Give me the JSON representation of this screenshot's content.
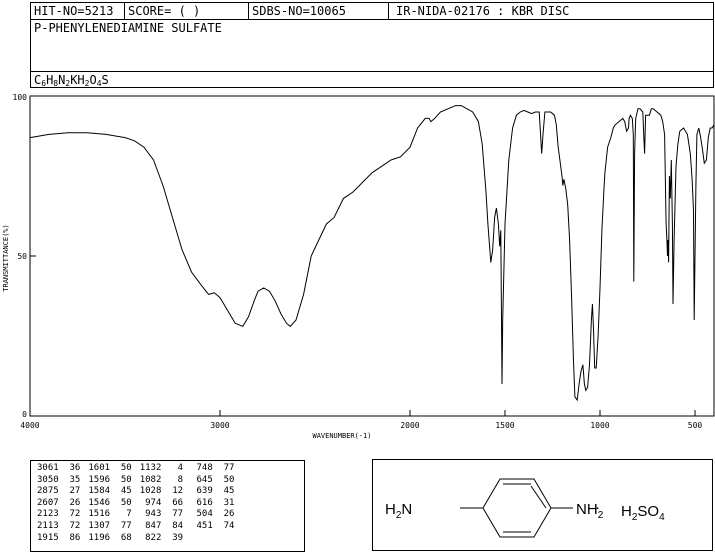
{
  "header": {
    "hit_no": "HIT-NO=5213",
    "score": "SCORE=  (   )",
    "sdbs_no": "SDBS-NO=10065",
    "ir_code": "IR-NIDA-02176 : KBR DISC",
    "compound_name": "P-PHENYLENEDIAMINE SULFATE",
    "formula": {
      "parts": [
        {
          "t": "C",
          "sub": "6"
        },
        {
          "t": "H",
          "sub": "8"
        },
        {
          "t": "N",
          "sub": "2"
        },
        {
          "t": "KH",
          "sub": "2"
        },
        {
          "t": "O",
          "sub": "4"
        },
        {
          "t": "S",
          "sub": ""
        }
      ]
    }
  },
  "chart_data": {
    "type": "line",
    "xlabel": "WAVENUMBER(-1)",
    "ylabel": "TRANSMITTANCE(%)",
    "xlim": [
      4000,
      400
    ],
    "ylim": [
      0,
      100
    ],
    "x_ticks": [
      4000,
      3000,
      2000,
      1500,
      1000,
      500
    ],
    "y_ticks": [
      0,
      50,
      100
    ],
    "grid": false,
    "series": [
      {
        "points": [
          [
            4000,
            87
          ],
          [
            3900,
            88
          ],
          [
            3800,
            88.5
          ],
          [
            3700,
            88.5
          ],
          [
            3600,
            88
          ],
          [
            3500,
            87
          ],
          [
            3450,
            86
          ],
          [
            3400,
            84
          ],
          [
            3350,
            80
          ],
          [
            3300,
            72
          ],
          [
            3250,
            62
          ],
          [
            3200,
            52
          ],
          [
            3150,
            45
          ],
          [
            3100,
            41
          ],
          [
            3060,
            38
          ],
          [
            3030,
            38.5
          ],
          [
            3000,
            37
          ],
          [
            2980,
            35
          ],
          [
            2950,
            32
          ],
          [
            2920,
            29
          ],
          [
            2880,
            28
          ],
          [
            2850,
            31
          ],
          [
            2820,
            36
          ],
          [
            2800,
            39
          ],
          [
            2770,
            40
          ],
          [
            2740,
            39
          ],
          [
            2710,
            36
          ],
          [
            2680,
            32
          ],
          [
            2650,
            29
          ],
          [
            2630,
            28
          ],
          [
            2600,
            30
          ],
          [
            2560,
            38
          ],
          [
            2520,
            50
          ],
          [
            2480,
            55
          ],
          [
            2440,
            60
          ],
          [
            2400,
            62
          ],
          [
            2350,
            68
          ],
          [
            2300,
            70
          ],
          [
            2250,
            73
          ],
          [
            2200,
            76
          ],
          [
            2150,
            78
          ],
          [
            2100,
            80
          ],
          [
            2050,
            81
          ],
          [
            2000,
            84
          ],
          [
            1960,
            90
          ],
          [
            1920,
            93
          ],
          [
            1900,
            93
          ],
          [
            1890,
            92
          ],
          [
            1870,
            93
          ],
          [
            1840,
            95
          ],
          [
            1800,
            96
          ],
          [
            1760,
            97
          ],
          [
            1730,
            97
          ],
          [
            1700,
            96
          ],
          [
            1670,
            95
          ],
          [
            1640,
            92
          ],
          [
            1620,
            85
          ],
          [
            1600,
            70
          ],
          [
            1590,
            60
          ],
          [
            1575,
            48
          ],
          [
            1565,
            52
          ],
          [
            1555,
            62
          ],
          [
            1545,
            65
          ],
          [
            1535,
            60
          ],
          [
            1528,
            53
          ],
          [
            1522,
            58
          ],
          [
            1516,
            10
          ],
          [
            1512,
            30
          ],
          [
            1500,
            60
          ],
          [
            1480,
            80
          ],
          [
            1460,
            90
          ],
          [
            1440,
            94
          ],
          [
            1420,
            95
          ],
          [
            1400,
            95.5
          ],
          [
            1380,
            95
          ],
          [
            1360,
            94.5
          ],
          [
            1340,
            95
          ],
          [
            1320,
            95
          ],
          [
            1307,
            82
          ],
          [
            1300,
            88
          ],
          [
            1290,
            95
          ],
          [
            1270,
            95
          ],
          [
            1260,
            95
          ],
          [
            1240,
            94
          ],
          [
            1230,
            91
          ],
          [
            1220,
            84
          ],
          [
            1200,
            75
          ],
          [
            1196,
            72
          ],
          [
            1190,
            74
          ],
          [
            1180,
            71
          ],
          [
            1170,
            66
          ],
          [
            1160,
            55
          ],
          [
            1150,
            38
          ],
          [
            1140,
            18
          ],
          [
            1132,
            6
          ],
          [
            1120,
            5
          ],
          [
            1110,
            10
          ],
          [
            1100,
            14
          ],
          [
            1090,
            16
          ],
          [
            1082,
            10
          ],
          [
            1075,
            8
          ],
          [
            1065,
            9
          ],
          [
            1055,
            16
          ],
          [
            1045,
            30
          ],
          [
            1040,
            35
          ],
          [
            1035,
            28
          ],
          [
            1028,
            15
          ],
          [
            1020,
            15
          ],
          [
            1010,
            25
          ],
          [
            1000,
            40
          ],
          [
            990,
            58
          ],
          [
            980,
            70
          ],
          [
            974,
            76
          ],
          [
            960,
            84
          ],
          [
            943,
            87
          ],
          [
            930,
            90
          ],
          [
            920,
            91
          ],
          [
            900,
            92
          ],
          [
            880,
            93
          ],
          [
            870,
            92
          ],
          [
            860,
            89
          ],
          [
            850,
            90
          ],
          [
            847,
            93
          ],
          [
            840,
            94
          ],
          [
            830,
            93
          ],
          [
            825,
            88
          ],
          [
            822,
            42
          ],
          [
            818,
            82
          ],
          [
            812,
            93
          ],
          [
            800,
            96
          ],
          [
            790,
            96
          ],
          [
            775,
            95
          ],
          [
            770,
            88
          ],
          [
            765,
            82
          ],
          [
            760,
            94
          ],
          [
            748,
            94
          ],
          [
            740,
            94
          ],
          [
            730,
            96
          ],
          [
            720,
            96
          ],
          [
            700,
            95
          ],
          [
            680,
            94
          ],
          [
            670,
            92
          ],
          [
            660,
            88
          ],
          [
            652,
            60
          ],
          [
            648,
            55
          ],
          [
            645,
            50
          ],
          [
            642,
            55
          ],
          [
            639,
            48
          ],
          [
            635,
            75
          ],
          [
            630,
            68
          ],
          [
            625,
            80
          ],
          [
            619,
            60
          ],
          [
            616,
            35
          ],
          [
            610,
            55
          ],
          [
            600,
            78
          ],
          [
            590,
            85
          ],
          [
            580,
            89
          ],
          [
            560,
            90
          ],
          [
            540,
            88
          ],
          [
            525,
            82
          ],
          [
            515,
            74
          ],
          [
            508,
            64
          ],
          [
            504,
            30
          ],
          [
            500,
            50
          ],
          [
            495,
            72
          ],
          [
            490,
            88
          ],
          [
            480,
            90
          ],
          [
            470,
            87
          ],
          [
            460,
            83
          ],
          [
            451,
            79
          ],
          [
            440,
            80
          ],
          [
            430,
            87
          ],
          [
            420,
            90
          ],
          [
            410,
            90
          ],
          [
            400,
            91
          ]
        ]
      }
    ],
    "peaks": [
      [
        "3061",
        "36"
      ],
      [
        "3050",
        "35"
      ],
      [
        "2875",
        "27"
      ],
      [
        "2607",
        "26"
      ],
      [
        "2123",
        "72"
      ],
      [
        "2113",
        "72"
      ],
      [
        "1915",
        "86"
      ],
      [
        "1601",
        "50"
      ],
      [
        "1596",
        "50"
      ],
      [
        "1584",
        "45"
      ],
      [
        "1546",
        "50"
      ],
      [
        "1516",
        "7"
      ],
      [
        "1307",
        "77"
      ],
      [
        "1196",
        "68"
      ],
      [
        "1132",
        "4"
      ],
      [
        "1082",
        "8"
      ],
      [
        "1028",
        "12"
      ],
      [
        "974",
        "66"
      ],
      [
        "943",
        "77"
      ],
      [
        "847",
        "84"
      ],
      [
        "822",
        "39"
      ],
      [
        "748",
        "77"
      ],
      [
        "645",
        "50"
      ],
      [
        "639",
        "45"
      ],
      [
        "616",
        "31"
      ],
      [
        "504",
        "26"
      ],
      [
        "451",
        "74"
      ]
    ]
  },
  "structure": {
    "left_group": "H2N",
    "right_group": "NH2",
    "dot": "·",
    "salt": "H2SO4"
  }
}
